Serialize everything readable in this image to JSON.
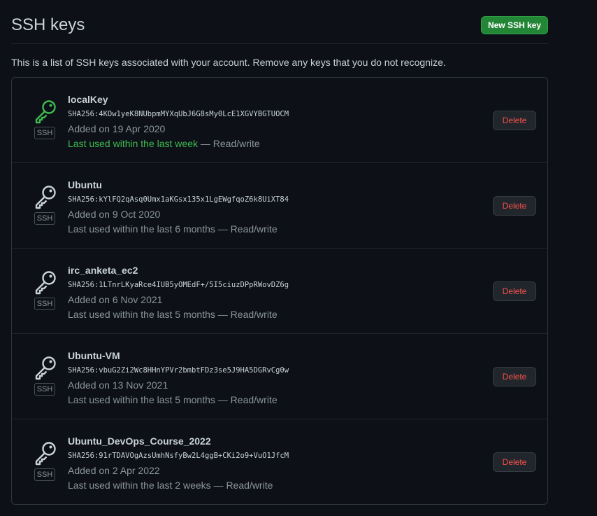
{
  "header": {
    "title": "SSH keys",
    "new_button_label": "New SSH key"
  },
  "intro_text": "This is a list of SSH keys associated with your account. Remove any keys that you do not recognize.",
  "delete_label": "Delete",
  "badge_label": "SSH",
  "colors": {
    "recent_green": "#3fb950",
    "delete_red": "#f85149",
    "primary_button": "#238636"
  },
  "keys": [
    {
      "name": "localKey",
      "fingerprint": "SHA256:4KOw1yeK8NUbpmMYXqUbJ6G8sMy0LcE1XGVYBGTUOCM",
      "added": "Added on 19 Apr 2020",
      "last_used": "Last used within the last week",
      "access": " — Read/write",
      "recent": true,
      "icon": "key-icon"
    },
    {
      "name": "Ubuntu",
      "fingerprint": "SHA256:kYlFQ2qAsq0Umx1aKGsx135x1LgEWgfqoZ6k8UiXT84",
      "added": "Added on 9 Oct 2020",
      "last_used": "Last used within the last 6 months",
      "access": " — Read/write",
      "recent": false,
      "icon": "key-icon"
    },
    {
      "name": "irc_anketa_ec2",
      "fingerprint": "SHA256:1LTnrLKyaRce4IUB5yOMEdF+/5I5ciuzDPpRWovDZ6g",
      "added": "Added on 6 Nov 2021",
      "last_used": "Last used within the last 5 months",
      "access": " — Read/write",
      "recent": false,
      "icon": "key-icon"
    },
    {
      "name": "Ubuntu-VM",
      "fingerprint": "SHA256:vbuG2Zi2Wc8HHnYPVr2bmbtFDz3se5J9HA5DGRvCg0w",
      "added": "Added on 13 Nov 2021",
      "last_used": "Last used within the last 5 months",
      "access": " — Read/write",
      "recent": false,
      "icon": "key-icon"
    },
    {
      "name": "Ubuntu_DevOps_Course_2022",
      "fingerprint": "SHA256:91rTDAVOgAzsUmhNsfyBw2L4ggB+CKi2o9+VuO1JfcM",
      "added": "Added on 2 Apr 2022",
      "last_used": "Last used within the last 2 weeks",
      "access": " — Read/write",
      "recent": false,
      "icon": "key-icon"
    }
  ]
}
